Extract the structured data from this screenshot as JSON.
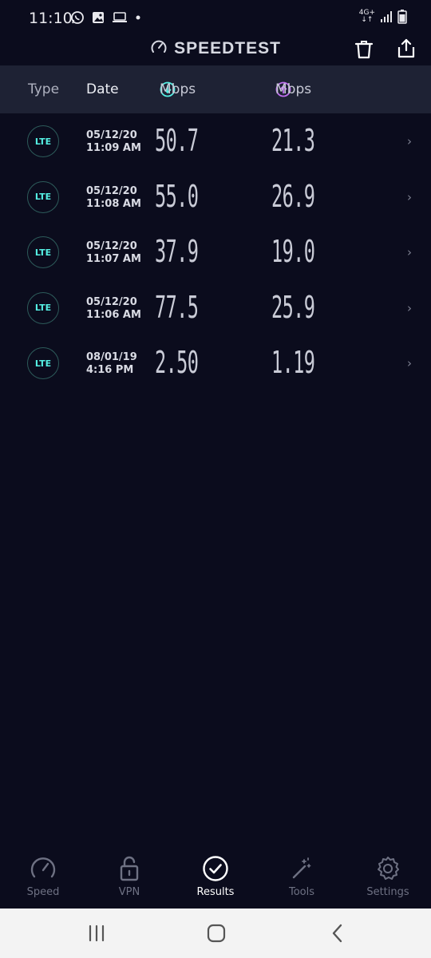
{
  "status_bar": {
    "time": "11:10",
    "network": "4G+",
    "icons_left": [
      "whatsapp-icon",
      "gallery-icon",
      "laptop-icon",
      "dot-icon"
    ],
    "icons_right": [
      "network-4g-icon",
      "signal-icon",
      "battery-icon"
    ]
  },
  "app": {
    "title": "SPEEDTEST"
  },
  "table_header": {
    "type": "Type",
    "date": "Date",
    "download": "Mbps",
    "upload": "Mbps"
  },
  "results": [
    {
      "type": "LTE",
      "date": "05/12/20",
      "time": "11:09 AM",
      "download": "50.7",
      "upload": "21.3"
    },
    {
      "type": "LTE",
      "date": "05/12/20",
      "time": "11:08 AM",
      "download": "55.0",
      "upload": "26.9"
    },
    {
      "type": "LTE",
      "date": "05/12/20",
      "time": "11:07 AM",
      "download": "37.9",
      "upload": "19.0"
    },
    {
      "type": "LTE",
      "date": "05/12/20",
      "time": "11:06 AM",
      "download": "77.5",
      "upload": "25.9"
    },
    {
      "type": "LTE",
      "date": "08/01/19",
      "time": "4:16 PM",
      "download": "2.50",
      "upload": "1.19"
    }
  ],
  "bottom_nav": {
    "speed": "Speed",
    "vpn": "VPN",
    "results": "Results",
    "tools": "Tools",
    "settings": "Settings",
    "active": "Results"
  },
  "colors": {
    "background": "#0b0c1d",
    "header": "#1e2234",
    "accent_download": "#55f0e4",
    "accent_upload": "#c070f0"
  }
}
